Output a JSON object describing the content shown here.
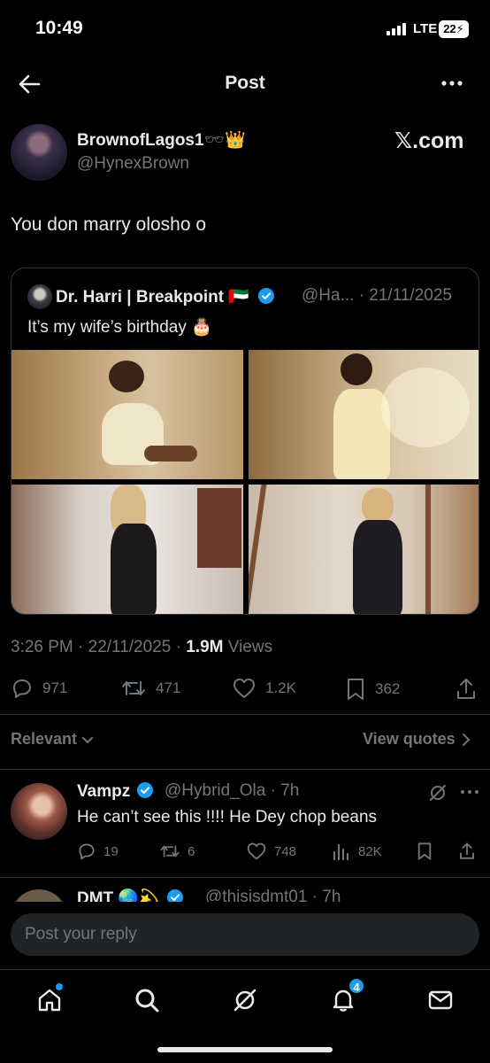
{
  "status_bar": {
    "time": "10:49",
    "network": "LTE",
    "battery": "22"
  },
  "header": {
    "title": "Post"
  },
  "post": {
    "author_name": "BrownofLagos1🕶️👑",
    "author_handle": "@HynexBrown",
    "watermark": "𝕏.com",
    "text": "You don marry olosho o",
    "quote": {
      "author_name": "Dr. Harri | Breakpoint 🇦🇪",
      "meta": "@Ha... · 21/11/2025",
      "text": "It’s my wife’s birthday 🎂"
    },
    "time": "3:26 PM · 22/11/2025 · ",
    "views_count": "1.9M",
    "views_label": " Views",
    "stats": {
      "replies": "971",
      "reposts": "471",
      "likes": "1.2K",
      "bookmarks": "362"
    }
  },
  "filters": {
    "sort_label": "Relevant",
    "view_quotes_label": "View quotes"
  },
  "replies": [
    {
      "name": "Vampz",
      "meta": "@Hybrid_Ola · 7h",
      "text": "He can’t see this !!!! He Dey chop beans",
      "stats": {
        "replies": "19",
        "reposts": "6",
        "likes": "748",
        "views": "82K"
      }
    },
    {
      "name": "DMT 🌏💫",
      "meta": "@thisisdmt01 · 7h"
    }
  ],
  "composer": {
    "placeholder": "Post your reply"
  },
  "nav": {
    "notification_count": "4"
  },
  "colors": {
    "accent": "#1d9bf0",
    "background": "#000000",
    "text": "#e7e9ea",
    "muted": "#71767b",
    "crown": "#f5b800"
  }
}
